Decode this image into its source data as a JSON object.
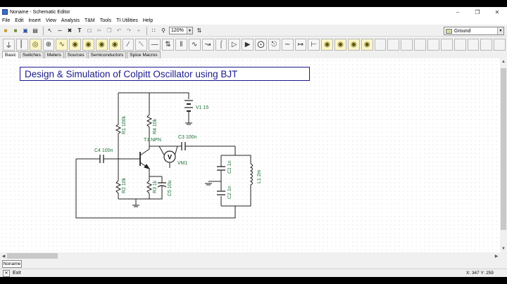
{
  "window": {
    "title": "Noname - Schematic Editor"
  },
  "menu": [
    "File",
    "Edit",
    "Insert",
    "View",
    "Analysis",
    "T&M",
    "Tools",
    "TI Utilities",
    "Help"
  ],
  "toolbar": {
    "zoom": "120%",
    "component_select": "Ground"
  },
  "tabs": [
    "Basic",
    "Switches",
    "Meters",
    "Sources",
    "Semiconductors",
    "Spice Macros"
  ],
  "heading": "Design & Simulation of Colpitt Oscillator using BJT",
  "components": {
    "V1": "V1 15",
    "R1": "R1 100k",
    "R4": "R4 10k",
    "T1": "T1 NPN",
    "C3": "C3 100n",
    "C4": "C4 100n",
    "VM1_meter": "V",
    "VM1": "VM1",
    "R2": "R2 10k",
    "R3": "R3 1k",
    "C5": "C5 10u",
    "C1": "C1 1n",
    "C2": "C2 1n",
    "L1": "L1 2m"
  },
  "sheet_tab": "Noname",
  "status": {
    "exit_label": "Exit",
    "coords": "X: 347  Y: 259"
  }
}
